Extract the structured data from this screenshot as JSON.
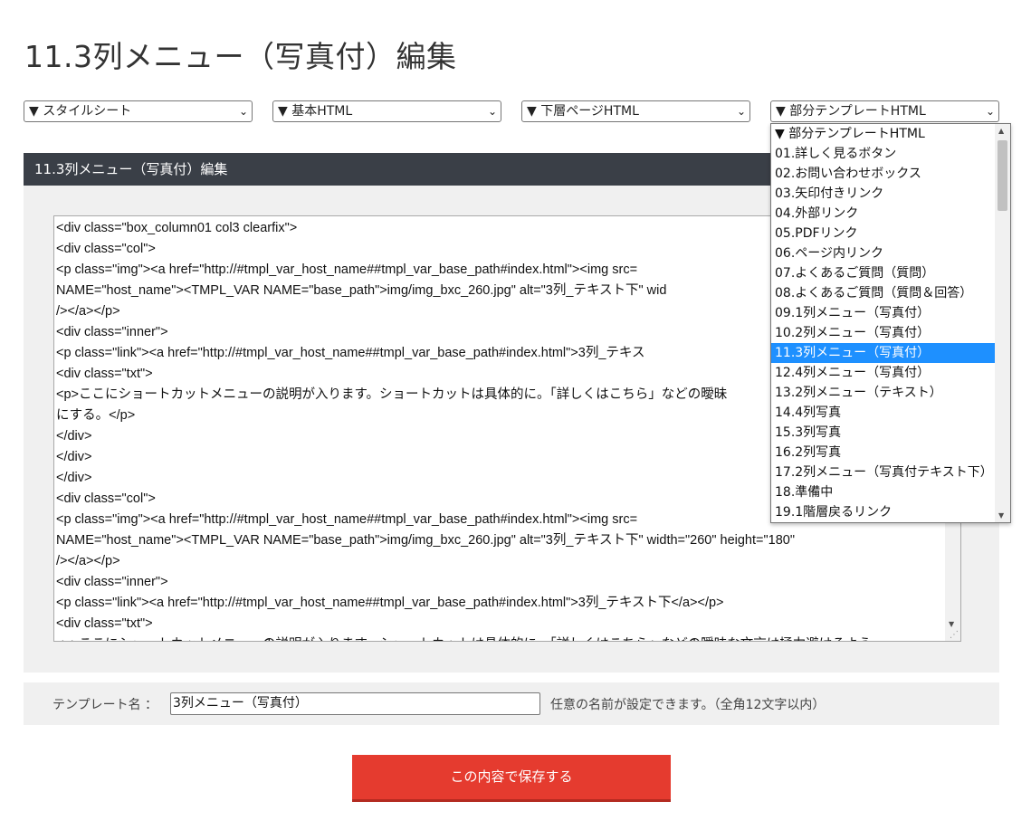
{
  "page": {
    "title": "11.3列メニュー（写真付）編集"
  },
  "selects": {
    "style": "▼ スタイルシート",
    "basic": "▼ 基本HTML",
    "lower": "▼ 下層ページHTML",
    "part": "▼ 部分テンプレートHTML"
  },
  "panel": {
    "header": "11.3列メニュー（写真付）編集"
  },
  "code_lines": [
    "<div class=\"box_column01 col3 clearfix\">",
    "<div class=\"col\">",
    "<p class=\"img\"><a href=\"http://#tmpl_var_host_name##tmpl_var_base_path#index.html\"><img src=",
    "NAME=\"host_name\"><TMPL_VAR NAME=\"base_path\">img/img_bxc_260.jpg\" alt=\"3列_テキスト下\" wid",
    "/></a></p>",
    "<div class=\"inner\">",
    "<p class=\"link\"><a href=\"http://#tmpl_var_host_name##tmpl_var_base_path#index.html\">3列_テキス",
    "<div class=\"txt\">",
    "<p>ここにショートカットメニューの説明が入ります。ショートカットは具体的に。「詳しくはこちら」などの曖昧",
    "にする。</p>",
    "</div>",
    "</div>",
    "</div>",
    "<div class=\"col\">",
    "<p class=\"img\"><a href=\"http://#tmpl_var_host_name##tmpl_var_base_path#index.html\"><img src=",
    "NAME=\"host_name\"><TMPL_VAR NAME=\"base_path\">img/img_bxc_260.jpg\" alt=\"3列_テキスト下\" width=\"260\" height=\"180\"",
    "/></a></p>",
    "<div class=\"inner\">",
    "<p class=\"link\"><a href=\"http://#tmpl_var_host_name##tmpl_var_base_path#index.html\">3列_テキスト下</a></p>",
    "<div class=\"txt\">",
    "<p>ここにショートカットメニューの説明が入ります。ショートカットは具体的に。「詳しくはこちら」などの曖昧な文言は極力避けるよう"
  ],
  "template_name": {
    "label": "テンプレート名 ：",
    "value": "3列メニュー（写真付）",
    "hint": "任意の名前が設定できます。（全角12文字以内）"
  },
  "save_button": "この内容で保存する",
  "dropdown_options": [
    "▼ 部分テンプレートHTML",
    "01.詳しく見るボタン",
    "02.お問い合わせボックス",
    "03.矢印付きリンク",
    "04.外部リンク",
    "05.PDFリンク",
    "06.ページ内リンク",
    "07.よくあるご質問（質問）",
    "08.よくあるご質問（質問＆回答）",
    "09.1列メニュー（写真付）",
    "10.2列メニュー（写真付）",
    "11.3列メニュー（写真付）",
    "12.4列メニュー（写真付）",
    "13.2列メニュー（テキスト）",
    "14.4列写真",
    "15.3列写真",
    "16.2列写真",
    "17.2列メニュー（写真付テキスト下）",
    "18.準備中",
    "19.1階層戻るリンク"
  ],
  "dropdown_selected_index": 11,
  "colors": {
    "header_bg": "#3a3f47",
    "save_button": "#e53b2f",
    "selected_option": "#1e90ff"
  }
}
